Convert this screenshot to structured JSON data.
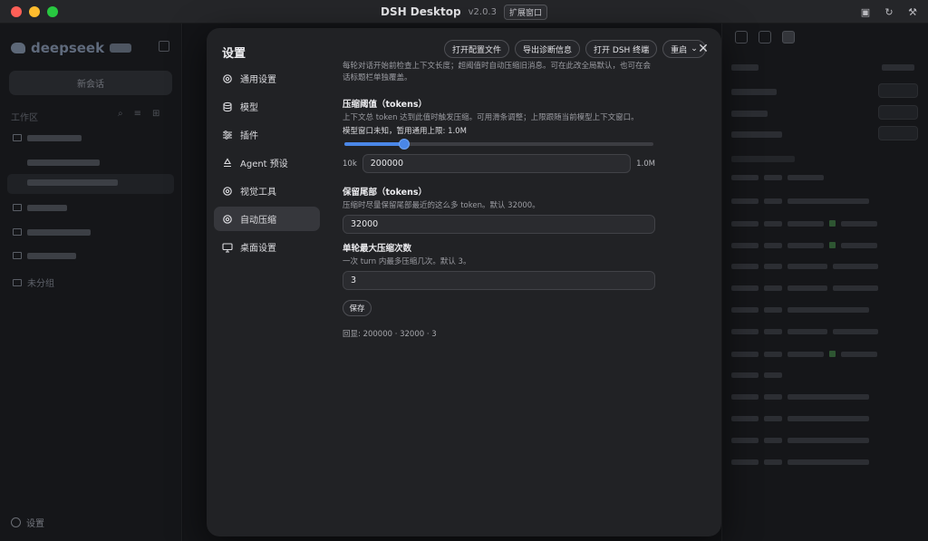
{
  "window": {
    "title": "DSH Desktop",
    "version": "v2.0.3",
    "expand_button": "扩展窗口"
  },
  "background_sidebar": {
    "logo": "deepseek",
    "new_chat": "新会话",
    "workspace_label": "工作区",
    "ungrouped": "未分组",
    "settings": "设置"
  },
  "settings": {
    "title": "设置",
    "nav": [
      {
        "label": "通用设置",
        "icon": "gear-icon"
      },
      {
        "label": "模型",
        "icon": "database-icon"
      },
      {
        "label": "插件",
        "icon": "sliders-icon"
      },
      {
        "label": "Agent 预设",
        "icon": "recycle-icon"
      },
      {
        "label": "视觉工具",
        "icon": "gear-icon"
      },
      {
        "label": "自动压缩",
        "icon": "gear-icon",
        "active": true
      },
      {
        "label": "桌面设置",
        "icon": "monitor-icon"
      }
    ],
    "actions": {
      "open_config": "打开配置文件",
      "export_diag": "导出诊断信息",
      "open_terminal": "打开 DSH 终端",
      "restart": "重启"
    },
    "intro": "每轮对话开始前检查上下文长度；超阈值时自动压缩旧消息。可在此改全局默认，也可在会话标题栏单独覆盖。",
    "threshold": {
      "title": "压缩阈值（tokens）",
      "desc": "上下文总 token 达到此值时触发压缩。可用滑条调整；上限跟随当前模型上下文窗口。",
      "note": "模型窗口未知，暂用通用上限: 1.0M",
      "min_label": "10k",
      "max_label": "1.0M",
      "value": "200000",
      "slider_fraction": 0.195
    },
    "tail": {
      "title": "保留尾部（tokens）",
      "desc": "压缩时尽量保留尾部最近的这么多 token。默认 32000。",
      "value": "32000"
    },
    "max_passes": {
      "title": "单轮最大压缩次数",
      "desc": "一次 turn 内最多压缩几次。默认 3。",
      "value": "3"
    },
    "save": "保存",
    "echo": "回显: 200000 · 32000 · 3"
  },
  "right_panel": {
    "tabs": [
      "files-icon",
      "branch-icon",
      "document-icon"
    ]
  }
}
